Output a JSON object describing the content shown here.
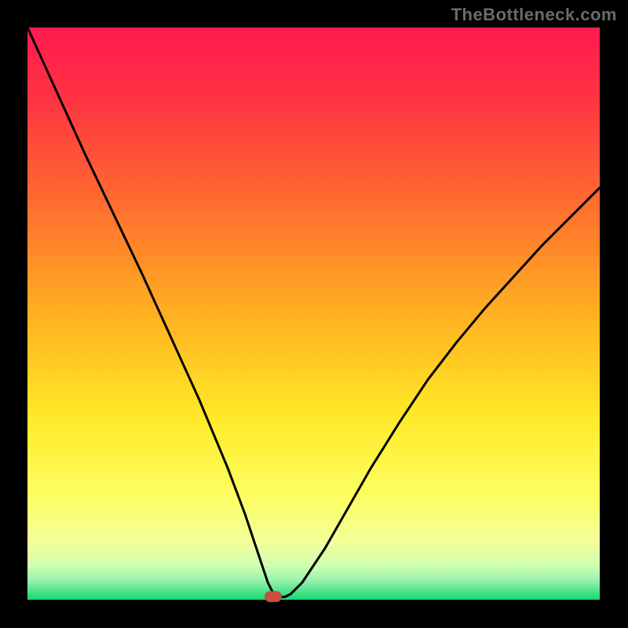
{
  "watermark": "TheBottleneck.com",
  "chart_data": {
    "type": "line",
    "title": "",
    "xlabel": "",
    "ylabel": "",
    "xlim": [
      0,
      100
    ],
    "ylim": [
      0,
      100
    ],
    "x": [
      0,
      5,
      10,
      15,
      20,
      25,
      30,
      35,
      38,
      40,
      41,
      42,
      43,
      44,
      45,
      46,
      48,
      52,
      56,
      60,
      65,
      70,
      75,
      80,
      85,
      90,
      95,
      100
    ],
    "values": [
      100,
      89,
      78,
      67.5,
      57,
      46,
      35,
      23,
      15,
      9,
      6,
      3,
      1,
      0.5,
      0.5,
      1,
      3,
      9,
      16,
      23,
      31,
      38.5,
      45,
      51,
      56.5,
      62,
      67,
      72
    ],
    "marker": {
      "x": 43,
      "y": 0.5,
      "color": "#c84e40",
      "shape": "pill"
    },
    "background_gradient": {
      "stops": [
        {
          "offset": 0,
          "color": "#ff1a50"
        },
        {
          "offset": 0.12,
          "color": "#ff3242"
        },
        {
          "offset": 0.3,
          "color": "#ff6a30"
        },
        {
          "offset": 0.5,
          "color": "#ffb020"
        },
        {
          "offset": 0.68,
          "color": "#ffe928"
        },
        {
          "offset": 0.82,
          "color": "#fdff62"
        },
        {
          "offset": 0.9,
          "color": "#f2ff9a"
        },
        {
          "offset": 0.94,
          "color": "#cfffb0"
        },
        {
          "offset": 0.965,
          "color": "#9cf3b0"
        },
        {
          "offset": 0.985,
          "color": "#4fe28c"
        },
        {
          "offset": 1.0,
          "color": "#19d870"
        }
      ]
    }
  }
}
